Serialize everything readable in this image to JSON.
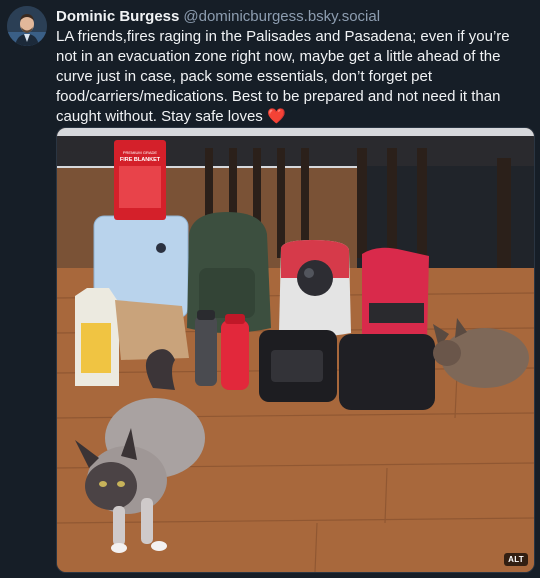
{
  "post": {
    "author_name": "Dominic Burgess",
    "author_handle": "@dominicburgess.bsky.social",
    "text": "LA friends,fires raging in the Palisades and Pasadena; even if you’re not in an evacuation zone right now, maybe get a little ahead of the curve just in case, pack some essentials, don’t forget pet food/carriers/medications. Best to be prepared and not need it than caught without. Stay safe loves",
    "emoji": "❤️",
    "image_alt_badge": "ALT",
    "image_labels": {
      "fire_blanket_top": "PREMIUM GRADE",
      "fire_blanket_title": "FIRE BLANKET"
    }
  },
  "colors": {
    "background": "#161e27",
    "text": "#f1f3f5",
    "handle": "#8d9db0",
    "floor": "#a8683c"
  },
  "icons": {
    "avatar": "avatar-photo",
    "heart": "red-heart-emoji"
  }
}
